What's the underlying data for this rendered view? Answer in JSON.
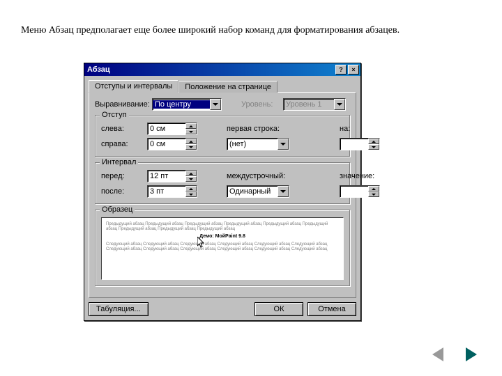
{
  "caption": "Меню Абзац предполагает еще более широкий набор команд для форматирования абзацев.",
  "dialog": {
    "title": "Абзац",
    "tabs": {
      "indents": "Отступы и интервалы",
      "flow": "Положение на странице"
    },
    "alignment_label": "Выравнивание:",
    "alignment_value": "По центру",
    "level_label": "Уровень:",
    "level_value": "Уровень 1",
    "indent": {
      "group": "Отступ",
      "left_label": "слева:",
      "left_value": "0 см",
      "right_label": "справа:",
      "right_value": "0 см",
      "first_label": "первая строка:",
      "first_value": "(нет)",
      "by_label": "на:",
      "by_value": ""
    },
    "spacing": {
      "group": "Интервал",
      "before_label": "перед:",
      "before_value": "12 пт",
      "after_label": "после:",
      "after_value": "3 пт",
      "line_label": "междустрочный:",
      "line_value": "Одинарный",
      "at_label": "значение:",
      "at_value": ""
    },
    "preview_group": "Образец",
    "preview_sample": "Демо: МойPaint 9.8",
    "preview_filler1": "Предыдущий абзац Предыдущий абзац Предыдущий абзац Предыдущий абзац Предыдущий абзац Предыдущий абзац Предыдущий абзац Предыдущий абзац Предыдущий абзац",
    "preview_filler2": "Следующий абзац Следующий абзац Следующий абзац Следующий абзац Следующий абзац Следующий абзац Следующий абзац Следующий абзац Следующий абзац Следующий абзац Следующий абзац Следующий абзац",
    "buttons": {
      "tabs": "Табуляция...",
      "ok": "ОК",
      "cancel": "Отмена"
    }
  }
}
